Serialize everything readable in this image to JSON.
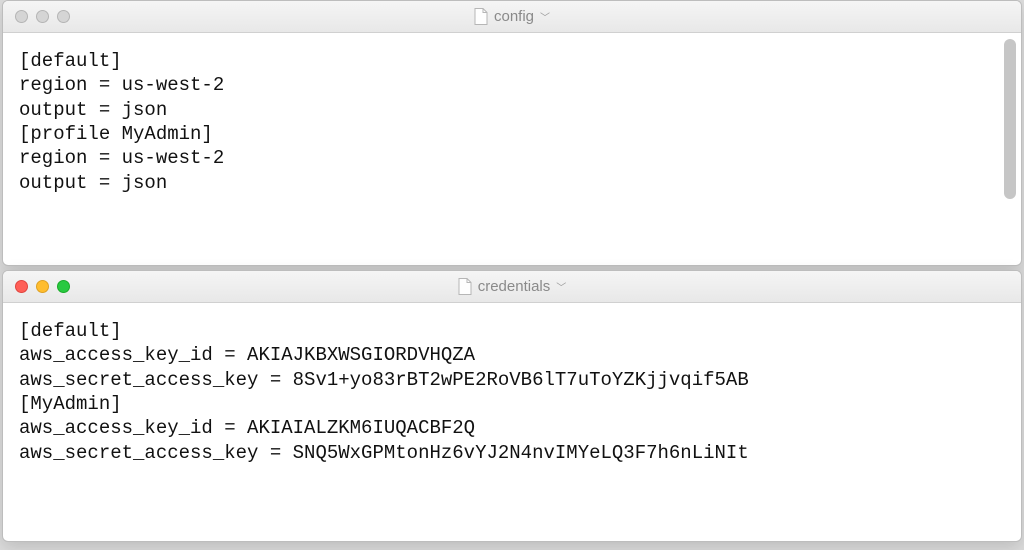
{
  "window1": {
    "filename": "config",
    "lines": [
      "[default]",
      "region = us-west-2",
      "output = json",
      "[profile MyAdmin]",
      "region = us-west-2",
      "output = json"
    ],
    "traffic_active": false
  },
  "window2": {
    "filename": "credentials",
    "lines": [
      "[default]",
      "aws_access_key_id = AKIAJKBXWSGIORDVHQZA",
      "aws_secret_access_key = 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",
      "[MyAdmin]",
      "aws_access_key_id = AKIAIALZKM6IUQACBF2Q",
      "aws_secret_access_key = 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"
    ],
    "traffic_active": true
  }
}
